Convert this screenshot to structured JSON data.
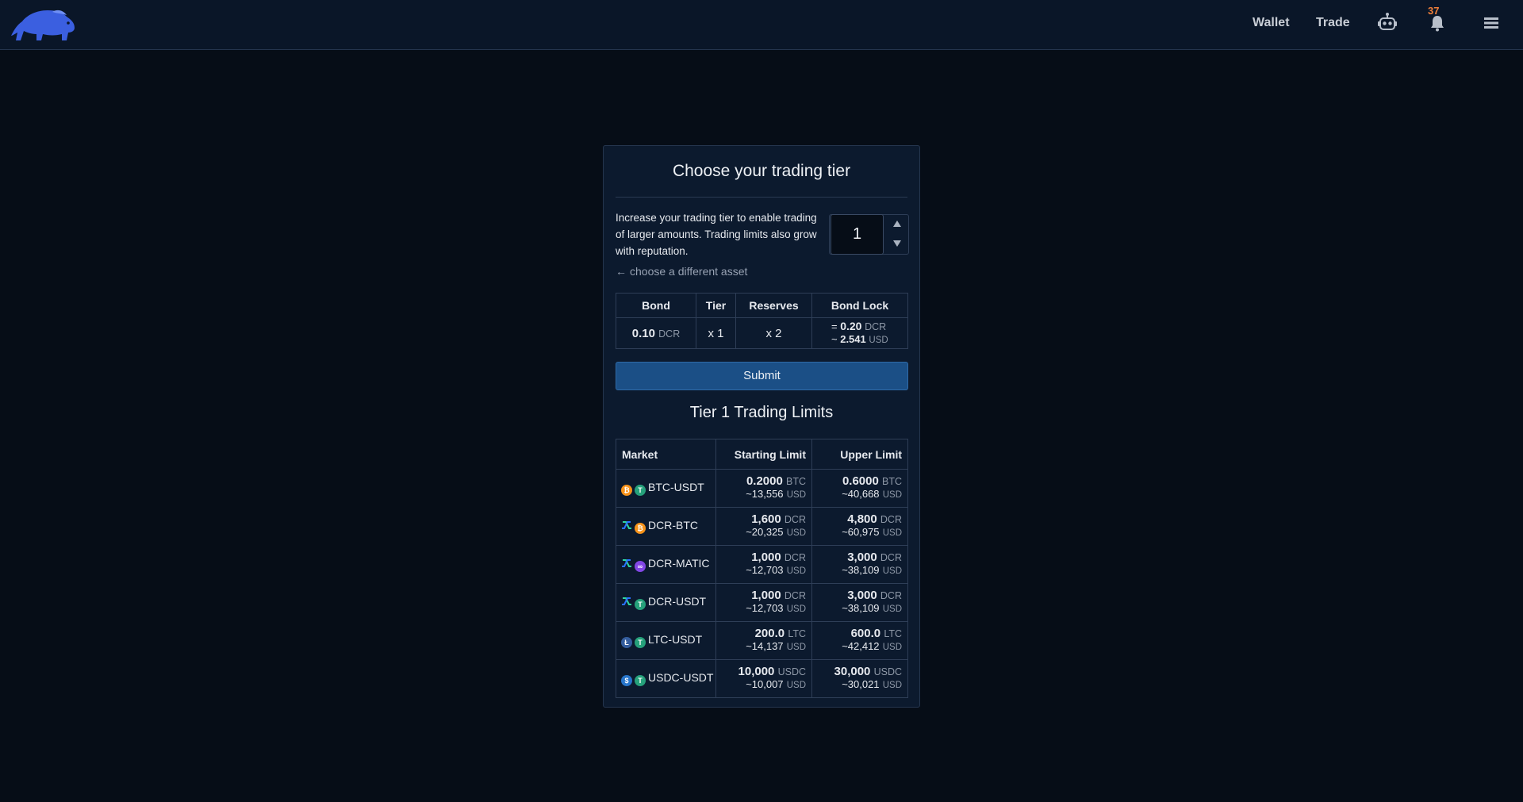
{
  "header": {
    "logo_icon": "bison-logo",
    "nav": {
      "wallet": "Wallet",
      "trade": "Trade"
    },
    "notification_count": "37"
  },
  "card": {
    "title": "Choose your trading tier",
    "intro": "Increase your trading tier to enable trading of larger amounts. Trading limits also grow with reputation.",
    "back_link": "choose a different asset",
    "tier_value": "1",
    "bond_table": {
      "headers": [
        "Bond",
        "Tier",
        "Reserves",
        "Bond Lock"
      ],
      "bond_amount": "0.10",
      "bond_unit": "DCR",
      "tier": "x 1",
      "reserves": "x 2",
      "lock_prefix_eq": "=",
      "lock_dcr": "0.20",
      "lock_dcr_unit": "DCR",
      "lock_prefix_approx": "~",
      "lock_usd": "2.541",
      "lock_usd_unit": "USD"
    },
    "submit_label": "Submit",
    "limits_title": "Tier 1 Trading Limits",
    "limits_headers": [
      "Market",
      "Starting Limit",
      "Upper Limit"
    ],
    "markets": [
      {
        "name": "BTC-USDT",
        "base_icon": "btc",
        "quote_icon": "usdt",
        "start": "0.2000",
        "start_unit": "BTC",
        "start_usd": "~13,556",
        "upper": "0.6000",
        "upper_unit": "BTC",
        "upper_usd": "~40,668"
      },
      {
        "name": "DCR-BTC",
        "base_icon": "dcr",
        "quote_icon": "btc",
        "start": "1,600",
        "start_unit": "DCR",
        "start_usd": "~20,325",
        "upper": "4,800",
        "upper_unit": "DCR",
        "upper_usd": "~60,975"
      },
      {
        "name": "DCR-MATIC",
        "base_icon": "dcr",
        "quote_icon": "matic",
        "start": "1,000",
        "start_unit": "DCR",
        "start_usd": "~12,703",
        "upper": "3,000",
        "upper_unit": "DCR",
        "upper_usd": "~38,109"
      },
      {
        "name": "DCR-USDT",
        "base_icon": "dcr",
        "quote_icon": "usdt",
        "start": "1,000",
        "start_unit": "DCR",
        "start_usd": "~12,703",
        "upper": "3,000",
        "upper_unit": "DCR",
        "upper_usd": "~38,109"
      },
      {
        "name": "LTC-USDT",
        "base_icon": "ltc",
        "quote_icon": "usdt",
        "start": "200.0",
        "start_unit": "LTC",
        "start_usd": "~14,137",
        "upper": "600.0",
        "upper_unit": "LTC",
        "upper_usd": "~42,412"
      },
      {
        "name": "USDC-USDT",
        "base_icon": "usdc",
        "quote_icon": "usdt",
        "start": "10,000",
        "start_unit": "USDC",
        "start_usd": "~10,007",
        "upper": "30,000",
        "upper_unit": "USDC",
        "upper_usd": "~30,021"
      }
    ],
    "usd_unit": "USD"
  },
  "colors": {
    "background": "#060d17",
    "card": "#0c1a2e",
    "accent": "#1b4f86",
    "notification": "#f0803a"
  }
}
